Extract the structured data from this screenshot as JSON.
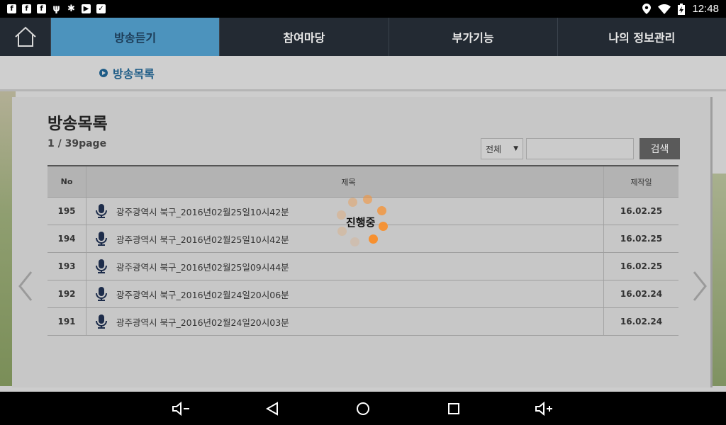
{
  "status": {
    "clock": "12:48"
  },
  "nav": {
    "tabs": [
      {
        "label": "방송듣기"
      },
      {
        "label": "참여마당"
      },
      {
        "label": "부가기능"
      },
      {
        "label": "나의 정보관리"
      }
    ]
  },
  "breadcrumb": {
    "label": "방송목록"
  },
  "panel": {
    "title": "방송목록",
    "page_info": "1 / 39page"
  },
  "search": {
    "select_value": "전체",
    "button_label": "검색"
  },
  "table": {
    "headers": {
      "no": "No",
      "title": "제목",
      "date": "제작일"
    },
    "rows": [
      {
        "no": "195",
        "title": "광주광역시 북구_2016년02월25일10시42분",
        "date": "16.02.25"
      },
      {
        "no": "194",
        "title": "광주광역시 북구_2016년02월25일10시42분",
        "date": "16.02.25"
      },
      {
        "no": "193",
        "title": "광주광역시 북구_2016년02월25일09시44분",
        "date": "16.02.25"
      },
      {
        "no": "192",
        "title": "광주광역시 북구_2016년02월24일20시06분",
        "date": "16.02.24"
      },
      {
        "no": "191",
        "title": "광주광역시 북구_2016년02월24일20시03분",
        "date": "16.02.24"
      }
    ]
  },
  "loading": {
    "text": "진행중"
  },
  "colors": {
    "nav_bg": "#232a33",
    "nav_active": "#4c93bd",
    "accent_blue": "#1e5c86",
    "spinner": "#f7902f"
  }
}
